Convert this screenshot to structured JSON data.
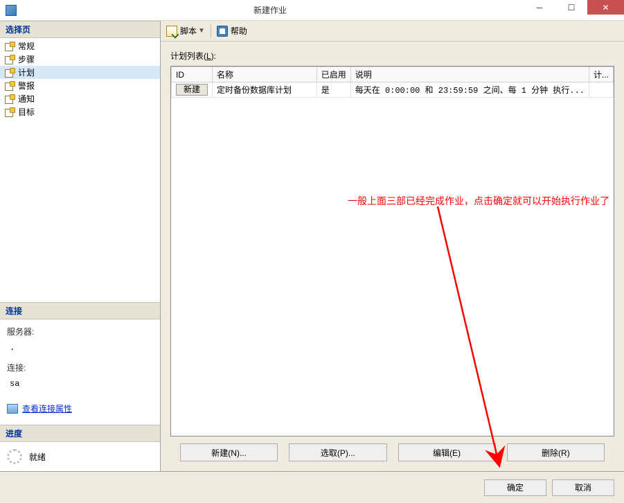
{
  "titlebar": {
    "title": "新建作业"
  },
  "sidebar": {
    "select_page_label": "选择页",
    "items": [
      {
        "label": "常规"
      },
      {
        "label": "步骤"
      },
      {
        "label": "计划"
      },
      {
        "label": "警报"
      },
      {
        "label": "通知"
      },
      {
        "label": "目标"
      }
    ],
    "selected_index": 2,
    "connection": {
      "header": "连接",
      "server_label": "服务器:",
      "server_value": ".",
      "conn_label": "连接:",
      "conn_value": "sa",
      "view_props_label": "查看连接属性"
    },
    "progress": {
      "header": "进度",
      "status": "就绪"
    }
  },
  "toolbar": {
    "script_label": "脚本",
    "help_label": "帮助"
  },
  "content": {
    "list_label_prefix": "计划列表(",
    "list_label_key": "L",
    "list_label_suffix": "):",
    "columns": {
      "id": "ID",
      "name": "名称",
      "enabled": "已启用",
      "description": "说明",
      "plan_short": "计..."
    },
    "rows": [
      {
        "id_button": "新建",
        "name": "定时备份数据库计划",
        "enabled": "是",
        "description": "每天在 0:00:00 和 23:59:59 之间、每 1 分钟 执行..."
      }
    ],
    "buttons": {
      "new": "新建(N)...",
      "pick": "选取(P)...",
      "edit": "编辑(E)",
      "delete": "删除(R)"
    }
  },
  "annotation": {
    "text": "一般上面三部已经完成作业，点击确定就可以开始执行作业了"
  },
  "footer": {
    "ok": "确定",
    "cancel": "取消"
  }
}
